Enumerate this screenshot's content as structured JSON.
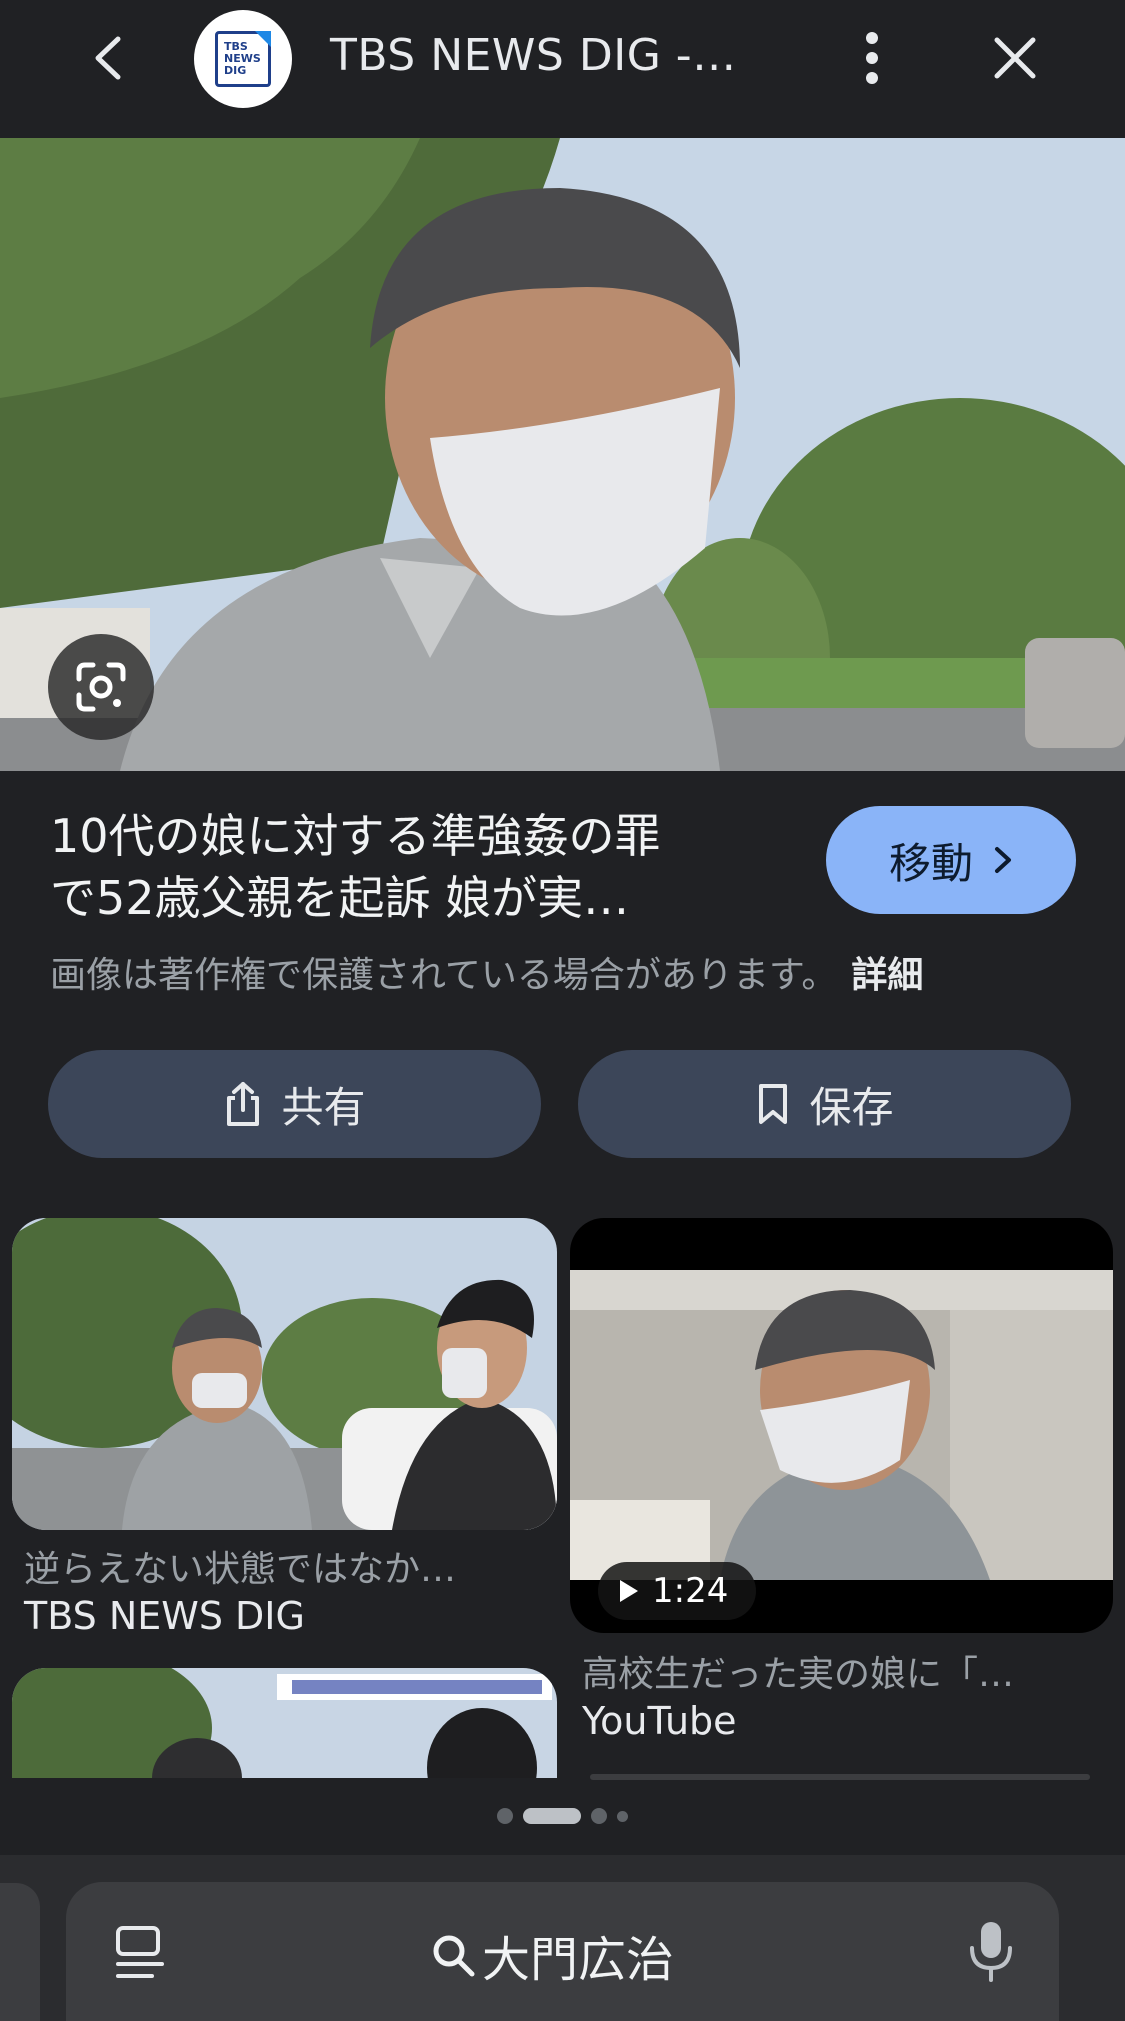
{
  "topbar": {
    "title": "TBS NEWS DIG -…",
    "logo_text": [
      "TBS",
      "NEWS",
      "DIG"
    ]
  },
  "hero": {
    "lens_icon": "google-lens-icon"
  },
  "article": {
    "headline_line1": "10代の娘に対する準強姦の罪",
    "headline_line2": "で52歳父親を起訴 娘が実…",
    "goto_label": "移動",
    "copyright_text": "画像は著作権で保護されている場合があります。",
    "detail_label": "詳細"
  },
  "actions": {
    "share_label": "共有",
    "save_label": "保存"
  },
  "related": [
    {
      "caption": "逆らえない状態ではなか…",
      "source": "TBS NEWS DIG"
    },
    {
      "caption": "高校生だった実の娘に「…",
      "source": "YouTube",
      "duration": "1:24"
    }
  ],
  "pager": {
    "count": 4,
    "active_index": 1
  },
  "bottombar": {
    "query": "大門広治"
  },
  "colors": {
    "background": "#202124",
    "accent_button": "#8ab4f8",
    "action_button": "#3c4659"
  }
}
